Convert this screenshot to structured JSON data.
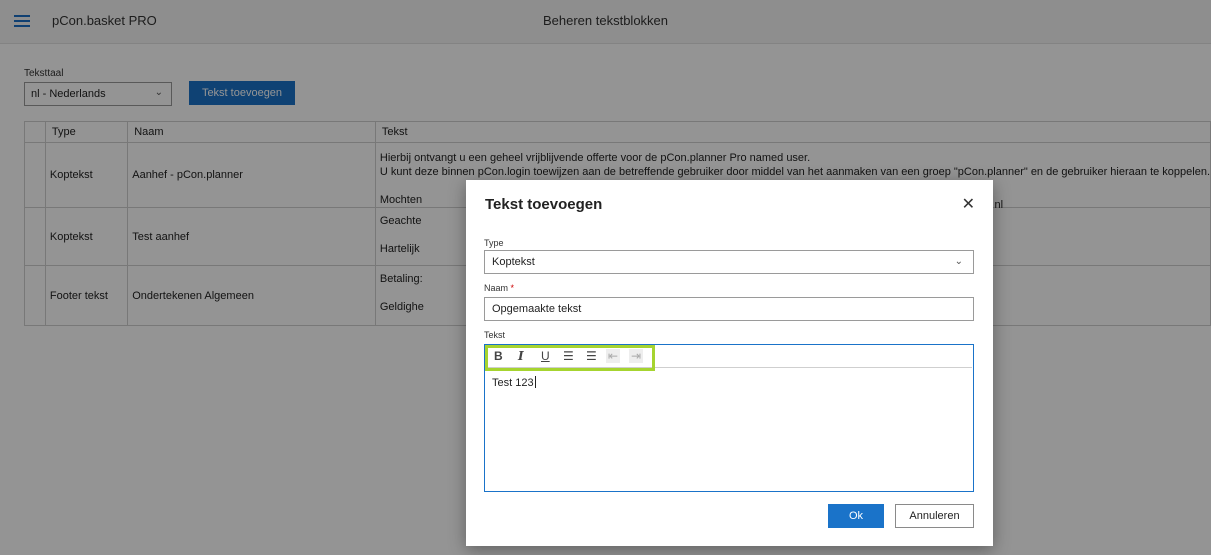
{
  "header": {
    "app_title": "pCon.basket PRO",
    "page_title": "Beheren tekstblokken"
  },
  "language": {
    "label": "Teksttaal",
    "selected": "nl - Nederlands"
  },
  "toolbar": {
    "add_text_label": "Tekst toevoegen"
  },
  "table": {
    "columns": [
      "Type",
      "Naam",
      "Tekst"
    ],
    "rows": [
      {
        "type": "Koptekst",
        "naam": "Aanhef - pCon.planner",
        "tekst": [
          "Hierbij ontvangt u een geheel vrijblijvende offerte voor de pCon.planner Pro named user.",
          "U kunt deze binnen pCon.login toewijzen aan de betreffende gebruiker door middel van het aanmaken van een groep \"pCon.planner\" en de gebruiker hieraan te koppelen.",
          "Mochten",
          "nl"
        ]
      },
      {
        "type": "Koptekst",
        "naam": "Test aanhef",
        "tekst": [
          "Geachte",
          "Hartelijk"
        ]
      },
      {
        "type": "Footer tekst",
        "naam": "Ondertekenen Algemeen",
        "tekst": [
          "Betaling:",
          "Geldighe"
        ]
      }
    ]
  },
  "dialog": {
    "title": "Tekst toevoegen",
    "type_label": "Type",
    "type_value": "Koptekst",
    "naam_label": "Naam",
    "naam_required": "*",
    "naam_value": "Opgemaakte tekst",
    "tekst_label": "Tekst",
    "editor_value": "Test 123",
    "ok_label": "Ok",
    "cancel_label": "Annuleren"
  },
  "editor_toolbar": {
    "bold": "B",
    "italic": "I",
    "underline": "U",
    "ordered_list": "☰",
    "bullet_list": "☰",
    "outdent": "⇤",
    "indent": "⇥"
  },
  "colors": {
    "accent": "#1a73c9",
    "highlight": "#a6d430"
  }
}
